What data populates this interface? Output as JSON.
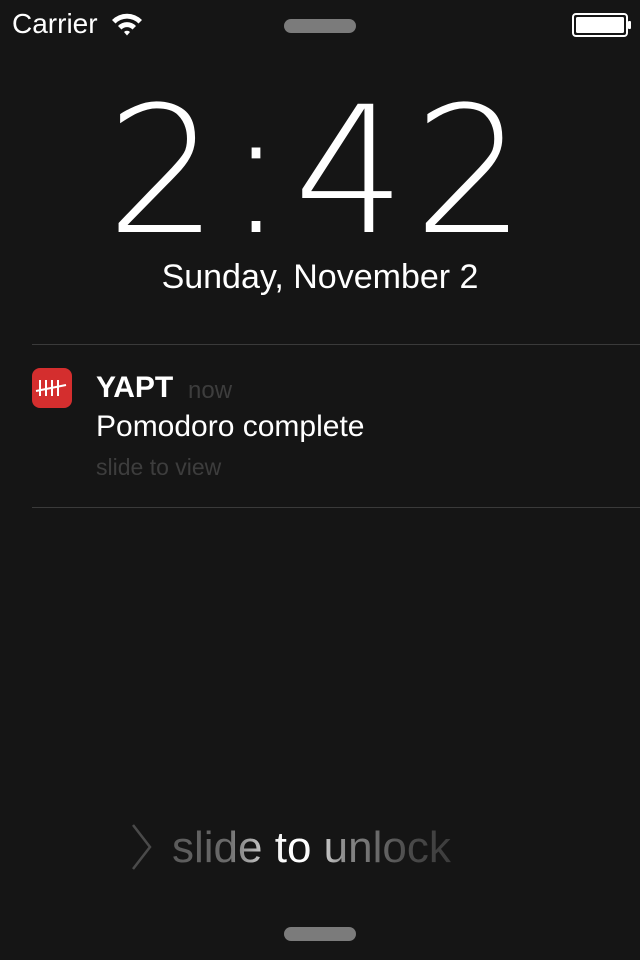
{
  "status_bar": {
    "carrier": "Carrier",
    "wifi_icon": "wifi-icon",
    "battery_icon": "battery-icon"
  },
  "lock_screen": {
    "time": "2:42",
    "date": "Sunday, November 2"
  },
  "notification": {
    "app_icon": "tally-marks-icon",
    "app_name": "YAPT",
    "time": "now",
    "message": "Pomodoro complete",
    "action": "slide to view"
  },
  "unlock": {
    "chevron_icon": "chevron-right-icon",
    "label": "slide to unlock"
  },
  "colors": {
    "background": "#151515",
    "app_icon": "#d42e2e",
    "muted_text": "#3d3d3d",
    "divider": "#3a3a3a"
  }
}
